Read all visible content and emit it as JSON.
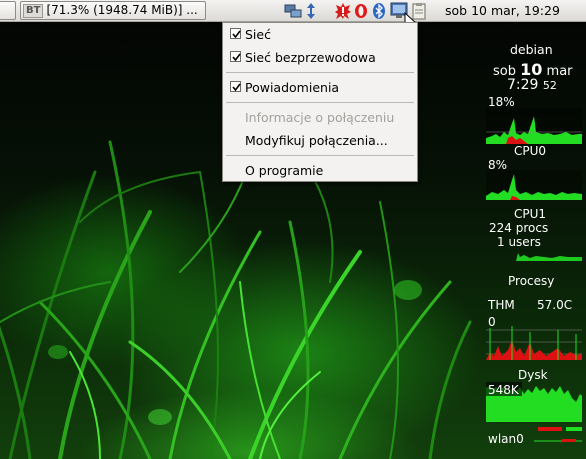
{
  "panel": {
    "task_first_label": "",
    "task_second_badge": "BT",
    "task_second_label": "[71.3% (1948.74 MiB)] ...",
    "tray_icons": [
      "network-transfer-icon",
      "volume-arrows-icon",
      "update-alert-icon",
      "opera-icon",
      "bluetooth-icon",
      "network-manager-icon",
      "clipboard-icon"
    ],
    "clock": "sob 10 mar, 19:29"
  },
  "menu": {
    "items": [
      {
        "label": "Sieć",
        "checked": true,
        "enabled": true
      },
      {
        "label": "Sieć bezprzewodowa",
        "checked": true,
        "enabled": true
      },
      {
        "label": "Powiadomienia",
        "checked": true,
        "enabled": true
      },
      {
        "label": "Informacje o połączeniu",
        "checked": false,
        "enabled": false
      },
      {
        "label": "Modyfikuj połączenia...",
        "checked": false,
        "enabled": true
      },
      {
        "label": "O programie",
        "checked": false,
        "enabled": true
      }
    ]
  },
  "conky": {
    "hostname": "debian",
    "day": "sob",
    "date_num": "10",
    "month": "mar",
    "time": "7:29",
    "seconds": "52",
    "cpu_total_pct": "18%",
    "cpu0_label": "CPU0",
    "cpu0_pct": "8%",
    "cpu1_label": "CPU1",
    "procs": "224 procs",
    "users": "1 users",
    "procesy_label": "Procesy",
    "thm_label": "THM",
    "thm_value": "57.0C",
    "zero": "0",
    "disk_label": "Dysk",
    "disk_value": "548K",
    "net_label": "wlan0"
  },
  "colors": {
    "accent_green": "#22dd22",
    "alert_red": "#dd1111"
  }
}
